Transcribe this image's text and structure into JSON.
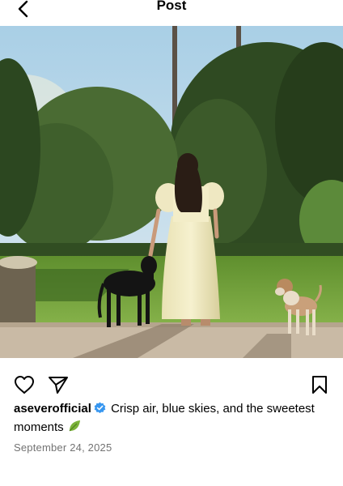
{
  "header": {
    "title": "Post",
    "back_icon": "chevron-left-icon"
  },
  "post": {
    "image_description_icon": "photo",
    "actions": {
      "like_icon": "heart-icon",
      "share_icon": "send-icon",
      "save_icon": "bookmark-icon"
    },
    "username": "aseverofficial",
    "verified": true,
    "caption": "Crisp air, blue skies, and the sweetest moments",
    "caption_emoji_icon": "leaf-icon",
    "date": "September 24, 2025"
  },
  "colors": {
    "verified_badge": "#3897f0",
    "date_text": "#737373"
  }
}
